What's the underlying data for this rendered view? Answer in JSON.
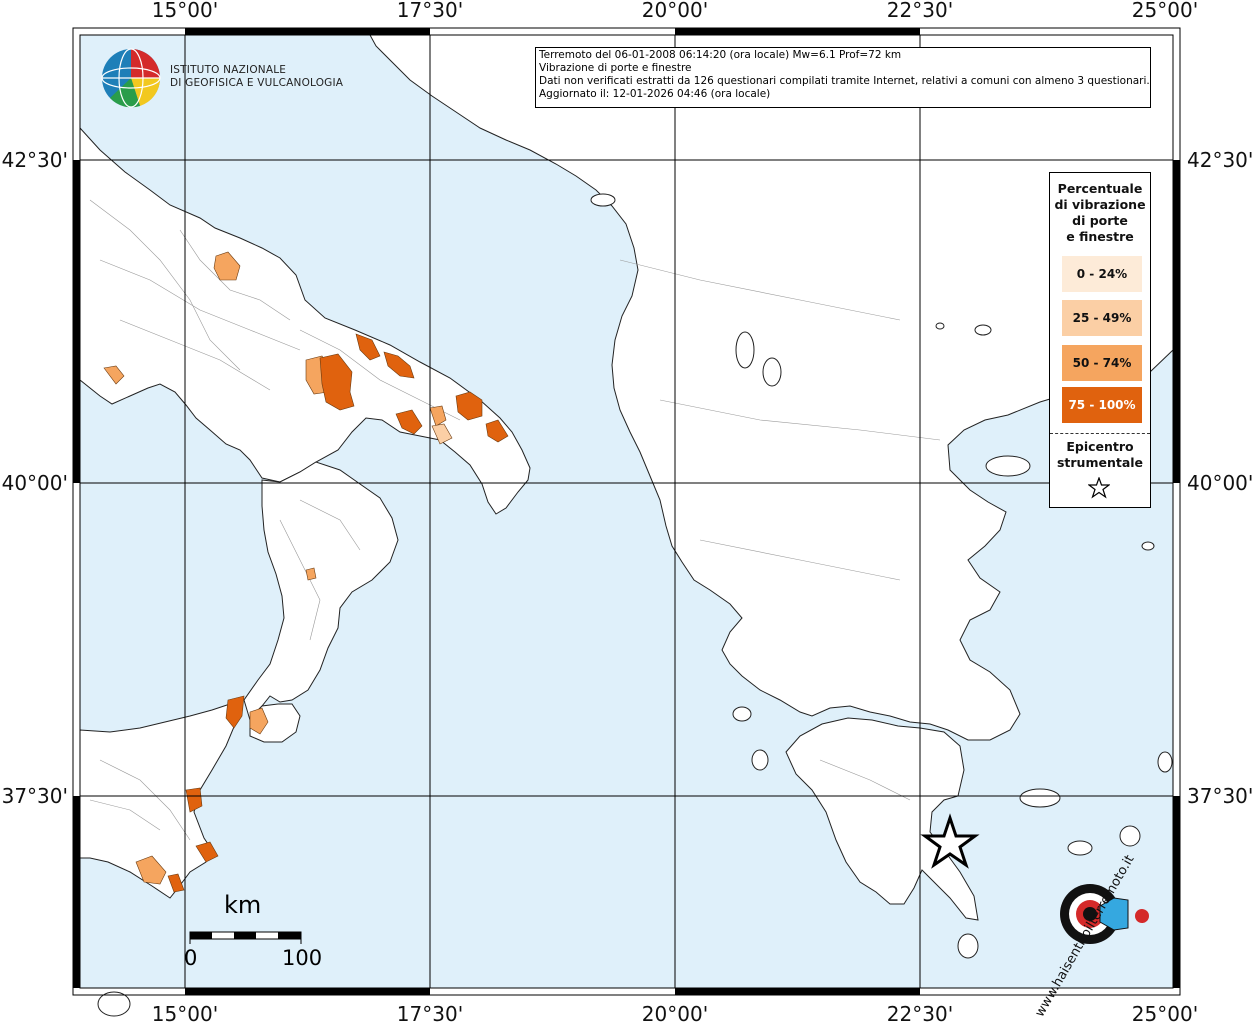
{
  "map": {
    "longitude_ticks": [
      "15°00'",
      "17°30'",
      "20°00'",
      "22°30'",
      "25°00'"
    ],
    "latitude_ticks": [
      "42°30'",
      "40°00'",
      "37°30'"
    ],
    "colors": {
      "sea": "#dff0fa",
      "land": "#ffffff",
      "border": "#555555",
      "grid": "#000000"
    }
  },
  "logo": {
    "line1": "ISTITUTO NAZIONALE",
    "line2": "DI GEOFISICA E VULCANOLOGIA",
    "icon": "ingv-globe-icon"
  },
  "info": {
    "line1": "Terremoto del 06-01-2008 06:14:20 (ora locale) Mw=6.1 Prof=72 km",
    "line2": "Vibrazione di porte e finestre",
    "line3": "Dati non verificati estratti da 126 questionari compilati tramite Internet, relativi a comuni con almeno 3 questionari.",
    "line4": "Aggiornato il: 12-01-2026 04:46 (ora locale)"
  },
  "legend": {
    "title_lines": [
      "Percentuale",
      "di vibrazione",
      "di porte",
      "e finestre"
    ],
    "classes": [
      {
        "label": "0 - 24%",
        "color": "#fdebd8",
        "text_color": "#111111"
      },
      {
        "label": "25 - 49%",
        "color": "#fbcfa5",
        "text_color": "#111111"
      },
      {
        "label": "50 - 74%",
        "color": "#f5a55f",
        "text_color": "#111111"
      },
      {
        "label": "75 - 100%",
        "color": "#e0620e",
        "text_color": "#ffffff"
      }
    ],
    "epicenter_lines": [
      "Epicentro",
      "strumentale"
    ],
    "epicenter_icon": "star-icon"
  },
  "scale": {
    "unit": "km",
    "min": "0",
    "max": "100"
  },
  "watermark": {
    "text": "www.haisentitoilterremoto.it",
    "icon": "speaker-target-icon"
  }
}
